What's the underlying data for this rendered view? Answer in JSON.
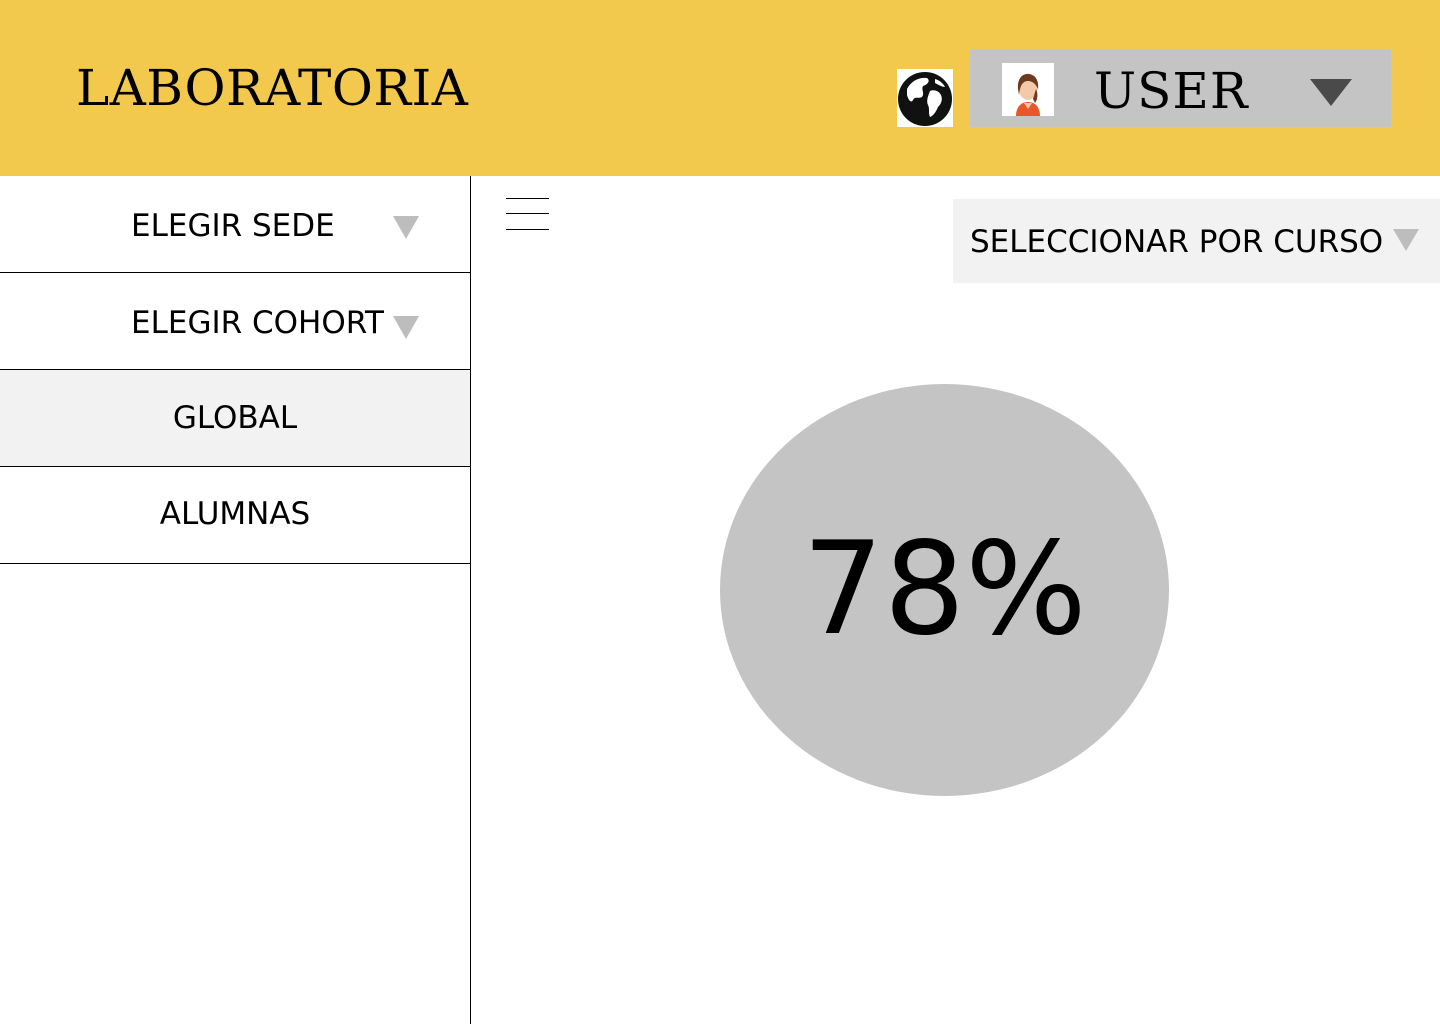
{
  "header": {
    "brand": "LABORATORIA",
    "language_icon": "globe-icon",
    "user": {
      "label": "USER",
      "avatar_icon": "user-avatar-icon",
      "caret_icon": "caret-down-icon"
    }
  },
  "sidebar": {
    "items": [
      {
        "label": "ELEGIR SEDE",
        "dropdown": true
      },
      {
        "label": "ELEGIR COHORT",
        "dropdown": true
      },
      {
        "label": "GLOBAL",
        "dropdown": false,
        "active": true
      },
      {
        "label": "ALUMNAS",
        "dropdown": false
      }
    ]
  },
  "main": {
    "menu_icon": "hamburger-menu-icon",
    "course_select": {
      "label": "SELECCIONAR POR CURSO",
      "caret_icon": "caret-down-icon"
    },
    "stat": {
      "value": "78%"
    }
  },
  "colors": {
    "header_bg": "#f2c94c",
    "user_menu_bg": "#c4c4c4",
    "active_item_bg": "#f2f2f2",
    "stat_circle": "#c4c4c4"
  }
}
